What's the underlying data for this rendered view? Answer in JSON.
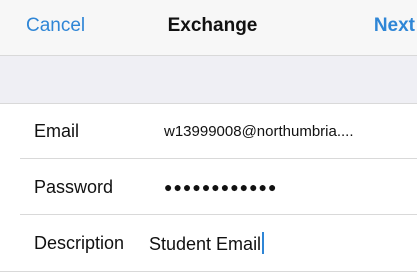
{
  "nav": {
    "cancel_label": "Cancel",
    "title": "Exchange",
    "next_label": "Next"
  },
  "form": {
    "email": {
      "label": "Email",
      "value": "w13999008@northumbria...."
    },
    "password": {
      "label": "Password",
      "value": "●●●●●●●●●●●●"
    },
    "description": {
      "label": "Description",
      "value": "Student Email"
    }
  },
  "colors": {
    "accent": "#2f86d6",
    "nav_background": "#f7f7f7",
    "group_background": "#efeff4",
    "separator": "#d9d9d9"
  }
}
